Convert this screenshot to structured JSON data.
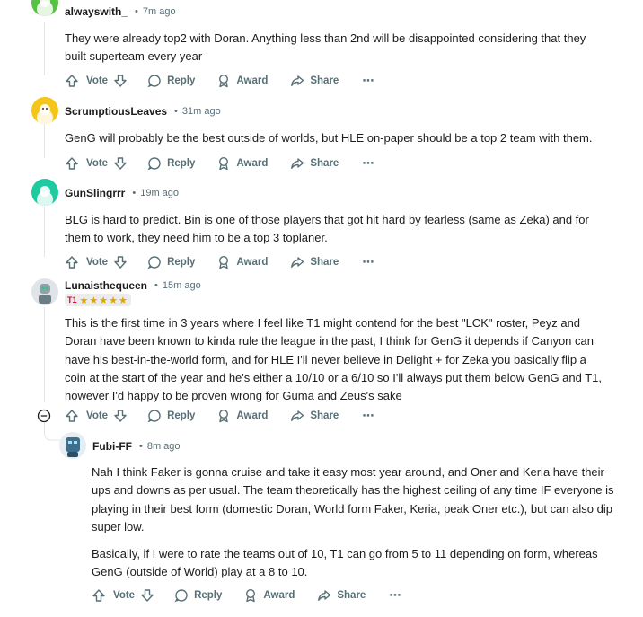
{
  "comments": [
    {
      "author": "alwayswith_",
      "time": "7m ago",
      "body": [
        "They were already top2 with Doran. Anything less than 2nd will be disappointed considering that they",
        "built superteam every year"
      ],
      "actions": {
        "vote": "Vote",
        "reply": "Reply",
        "award": "Award",
        "share": "Share",
        "more": "⋯"
      },
      "avatar_color": "#56c142"
    },
    {
      "author": "ScrumptiousLeaves",
      "time": "31m ago",
      "body": [
        "GenG will probably be the best outside of worlds, but HLE on-paper should be a top 2 team with them."
      ],
      "actions": {
        "vote": "Vote",
        "reply": "Reply",
        "award": "Award",
        "share": "Share",
        "more": "⋯"
      },
      "avatar_color": "#f5c518"
    },
    {
      "author": "GunSlingrrr",
      "time": "19m ago",
      "body": [
        "BLG is hard to predict. Bin is one of those players that got hit hard by fearless (same as Zeka) and for",
        "them to work, they need him to be a top 3 toplaner."
      ],
      "actions": {
        "vote": "Vote",
        "reply": "Reply",
        "award": "Award",
        "share": "Share",
        "more": "⋯"
      },
      "avatar_color": "#1ecaa0"
    },
    {
      "author": "Lunaisthequeen",
      "time": "15m ago",
      "flair": {
        "team": "T1",
        "stars": "★★★★★"
      },
      "body": [
        "This is the first time in 3 years where I feel like T1 might contend for the best \"LCK\" roster, Peyz and",
        "Doran have been known to kinda rule the league in the past, I think for GenG it depends if Canyon can",
        "have his best-in-the-world form, and for HLE I'll never believe in Delight + for Zeka you basically flip a",
        "coin at the start of the year and he's either a 10/10 or a 6/10 so I'll always put them below GenG and T1,",
        "however I'd happy to be proven wrong for Guma and Zeus's sake"
      ],
      "actions": {
        "vote": "Vote",
        "reply": "Reply",
        "award": "Award",
        "share": "Share",
        "more": "⋯"
      },
      "avatar_color": "#c9d1d6"
    },
    {
      "author": "Fubi-FF",
      "time": "8m ago",
      "body": [
        "Nah I think Faker is gonna cruise and take it easy most year around, and Oner and Keria have their",
        "ups and downs as per usual. The team theoretically has the highest ceiling of any time IF everyone is",
        "playing in their best form (domestic Doran, World form Faker, Keria, peak Oner etc.), but can also dip",
        "super low."
      ],
      "body2": [
        "Basically, if I were to rate the teams out of 10, T1 can go from 5 to 11 depending on form, whereas",
        "GenG (outside of World) play at a 8 to 10."
      ],
      "actions": {
        "vote": "Vote",
        "reply": "Reply",
        "award": "Award",
        "share": "Share",
        "more": "⋯"
      },
      "avatar_color": "#3d6f8c"
    }
  ]
}
